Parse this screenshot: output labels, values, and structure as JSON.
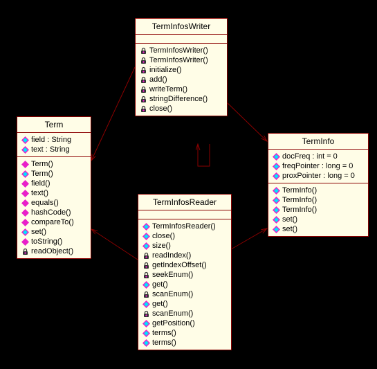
{
  "classes": {
    "termInfosWriter": {
      "name": "TermInfosWriter",
      "methods": [
        {
          "icon": "lock",
          "label": "TermInfosWriter()"
        },
        {
          "icon": "lock",
          "label": "TermInfosWriter()"
        },
        {
          "icon": "lock",
          "label": "initialize()"
        },
        {
          "icon": "lock",
          "label": "add()"
        },
        {
          "icon": "lock",
          "label": "writeTerm()"
        },
        {
          "icon": "lock",
          "label": "stringDifference()"
        },
        {
          "icon": "lock",
          "label": "close()"
        }
      ]
    },
    "term": {
      "name": "Term",
      "attrs": [
        {
          "icon": "pkg",
          "label": "field : String"
        },
        {
          "icon": "pkg",
          "label": "text : String"
        }
      ],
      "methods": [
        {
          "icon": "pub",
          "label": "Term()"
        },
        {
          "icon": "pkg",
          "label": "Term()"
        },
        {
          "icon": "pub",
          "label": "field()"
        },
        {
          "icon": "pub",
          "label": "text()"
        },
        {
          "icon": "pub",
          "label": "equals()"
        },
        {
          "icon": "pub",
          "label": "hashCode()"
        },
        {
          "icon": "pub",
          "label": "compareTo()"
        },
        {
          "icon": "pkg",
          "label": "set()"
        },
        {
          "icon": "pub",
          "label": "toString()"
        },
        {
          "icon": "lock",
          "label": "readObject()"
        }
      ]
    },
    "termInfosReader": {
      "name": "TermInfosReader",
      "methods": [
        {
          "icon": "pkg",
          "label": "TermInfosReader()"
        },
        {
          "icon": "pkg",
          "label": "close()"
        },
        {
          "icon": "pkg",
          "label": "size()"
        },
        {
          "icon": "lock",
          "label": "readIndex()"
        },
        {
          "icon": "lock",
          "label": "getIndexOffset()"
        },
        {
          "icon": "lock",
          "label": "seekEnum()"
        },
        {
          "icon": "pkg",
          "label": "get()"
        },
        {
          "icon": "lock",
          "label": "scanEnum()"
        },
        {
          "icon": "pkg",
          "label": "get()"
        },
        {
          "icon": "lock",
          "label": "scanEnum()"
        },
        {
          "icon": "pkg",
          "label": "getPosition()"
        },
        {
          "icon": "pkg",
          "label": "terms()"
        },
        {
          "icon": "pkg",
          "label": "terms()"
        }
      ]
    },
    "termInfo": {
      "name": "TermInfo",
      "attrs": [
        {
          "icon": "pkg",
          "label": "docFreq : int = 0"
        },
        {
          "icon": "pkg",
          "label": "freqPointer : long = 0"
        },
        {
          "icon": "pkg",
          "label": "proxPointer : long = 0"
        }
      ],
      "methods": [
        {
          "icon": "pkg",
          "label": "TermInfo()"
        },
        {
          "icon": "pkg",
          "label": "TermInfo()"
        },
        {
          "icon": "pkg",
          "label": "TermInfo()"
        },
        {
          "icon": "pkg",
          "label": "set()"
        },
        {
          "icon": "pkg",
          "label": "set()"
        }
      ]
    }
  }
}
